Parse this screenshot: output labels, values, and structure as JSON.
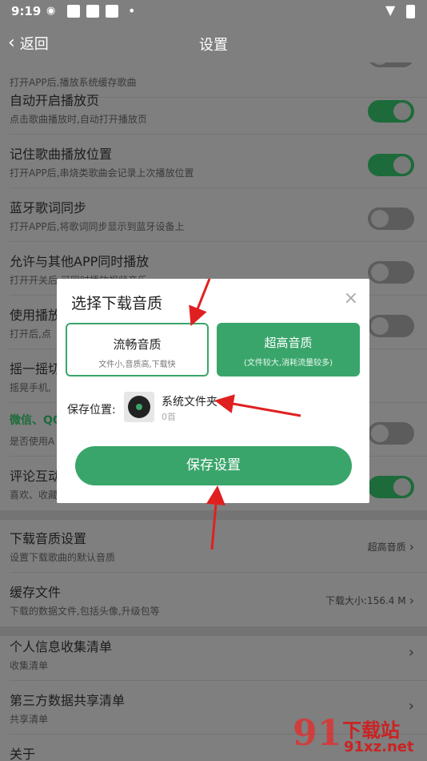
{
  "status_bar": {
    "time": "9:19",
    "weibo_icon": "weibo-icon",
    "dot": "•"
  },
  "header": {
    "back_label": "返回",
    "back_chevron": "‹",
    "title": "设置"
  },
  "settings": [
    {
      "main": "",
      "sub": "打开APP后,播放系统缓存歌曲",
      "toggle": "off"
    },
    {
      "main": "自动开启播放页",
      "sub": "点击歌曲播放时,自动打开播放页",
      "toggle": "on"
    },
    {
      "main": "记住歌曲播放位置",
      "sub": "打开APP后,串烧类歌曲会记录上次播放位置",
      "toggle": "on"
    },
    {
      "main": "蓝牙歌词同步",
      "sub": "打开APP后,将歌词同步显示到蓝牙设备上",
      "toggle": "off"
    },
    {
      "main": "允许与其他APP同时播放",
      "sub": "打开开关后,可同时播放视频音乐",
      "toggle": "off"
    },
    {
      "main": "使用播放",
      "sub": "打开后,点",
      "toggle": "off"
    },
    {
      "main": "摇一摇切",
      "sub": "摇晃手机,",
      "toggle": "off"
    },
    {
      "main": "微信、QQ",
      "sub": "是否使用A",
      "toggle": "off"
    },
    {
      "main": "评论互动",
      "sub": "喜欢、收藏",
      "toggle": "on"
    },
    {
      "main": "下载音质设置",
      "sub": "设置下载歌曲的默认音质",
      "right": "超高音质"
    },
    {
      "main": "缓存文件",
      "sub": "下载的数据文件,包括头像,升级包等",
      "right": "下载大小:156.4 M"
    },
    {
      "main": "个人信息收集清单",
      "sub": "收集清单"
    },
    {
      "main": "第三方数据共享清单",
      "sub": "共享清单"
    },
    {
      "main": "关于",
      "sub": ""
    }
  ],
  "dialog": {
    "title": "选择下载音质",
    "close": "×",
    "option_a": {
      "main": "流畅音质",
      "sub": "文件小,音质高,下载快"
    },
    "option_b": {
      "main": "超高音质",
      "sub": "(文件较大,消耗流量较多)"
    },
    "save_location_label": "保存位置:",
    "folder_name": "系统文件夹",
    "folder_count": "0首",
    "save_button": "保存设置"
  },
  "watermark": {
    "logo": "91",
    "line1": "下载站",
    "line2": "91xz.net"
  },
  "colors": {
    "accent": "#3aa56b",
    "overlay": "#7f7f7f",
    "arrow": "#e02020"
  }
}
